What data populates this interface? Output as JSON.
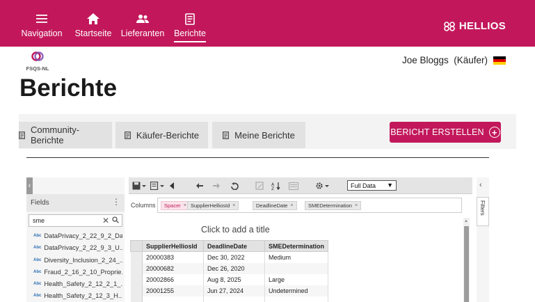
{
  "colors": {
    "brand": "#c2185b",
    "tab_bg": "#e2e2e2",
    "panel_bg": "#f3f3f3"
  },
  "nav": {
    "items": [
      {
        "label": "Navigation",
        "icon": "menu-icon",
        "active": false
      },
      {
        "label": "Startseite",
        "icon": "home-icon",
        "active": false
      },
      {
        "label": "Lieferanten",
        "icon": "people-icon",
        "active": false
      },
      {
        "label": "Berichte",
        "icon": "report-icon",
        "active": true
      }
    ],
    "brand": "HELLIOS"
  },
  "subheader": {
    "org_logo_text": "FSQS-NL",
    "user": "Joe Bloggs  (Käufer)",
    "flag": "germany-flag-icon"
  },
  "page": {
    "title": "Berichte"
  },
  "tabs": [
    {
      "label": "Community-Berichte",
      "icon": "document-icon"
    },
    {
      "label": "Käufer-Berichte",
      "icon": "document-icon"
    },
    {
      "label": "Meine Berichte",
      "icon": "document-icon"
    }
  ],
  "create_button": {
    "label": "BERICHT ERSTELLEN"
  },
  "field_panel": {
    "title": "Fields",
    "search_value": "sme",
    "fields": [
      "DataPrivacy_2_22_9_2_Da...",
      "DataPrivacy_2_22_9_3_U...",
      "Diversity_Inclusion_2_24_...",
      "Fraud_2_16_2_10_Proprie...",
      "Health_Safety_2_12_2_1_...",
      "Health_Safety_2_12_3_H..."
    ],
    "field_type_badge": "Abc"
  },
  "toolbar": {
    "data_mode": "Full Data"
  },
  "columns": {
    "label": "Columns",
    "chips": [
      "Spacer",
      "SupplierHelliosId",
      "DeadlineDate",
      "SMEDetermination"
    ]
  },
  "report": {
    "title_placeholder": "Click to add a title",
    "headers": [
      "SupplierHelliosId",
      "DeadlineDate",
      "SMEDetermination"
    ],
    "rows": [
      [
        "20000383",
        "Dec 30, 2022",
        "Medium"
      ],
      [
        "20000682",
        "Dec 26, 2020",
        ""
      ],
      [
        "20002866",
        "Aug 8, 2025",
        "Large"
      ],
      [
        "20001255",
        "Jun 27, 2024",
        "Undetermined"
      ],
      [
        "",
        "",
        ""
      ]
    ]
  },
  "right_rail": {
    "filters_label": "Filters"
  }
}
